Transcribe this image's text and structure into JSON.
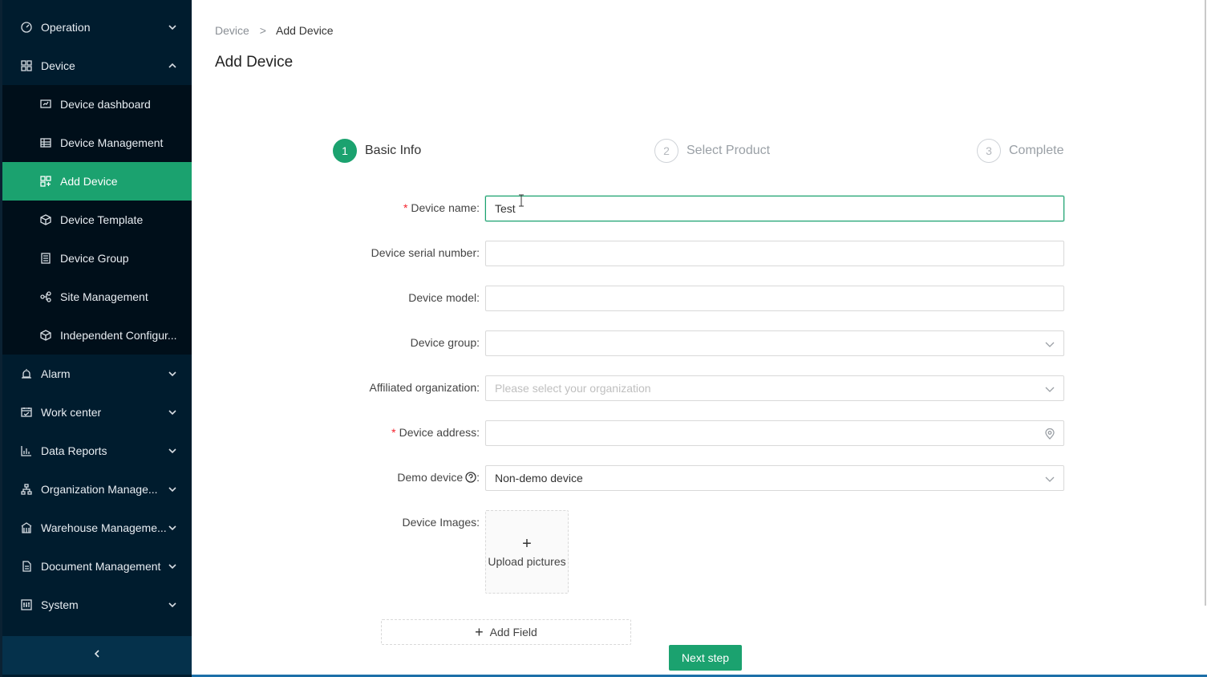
{
  "sidebar": {
    "items": [
      {
        "label": "Operation",
        "icon": "dashboard-gauge-icon"
      },
      {
        "label": "Device",
        "icon": "grid-apps-icon"
      },
      {
        "label": "Device dashboard",
        "icon": "chart-board-icon"
      },
      {
        "label": "Device Management",
        "icon": "table-icon"
      },
      {
        "label": "Add Device",
        "icon": "grid-add-icon"
      },
      {
        "label": "Device Template",
        "icon": "cube-template-icon"
      },
      {
        "label": "Device Group",
        "icon": "list-group-icon"
      },
      {
        "label": "Site Management",
        "icon": "site-nodes-icon"
      },
      {
        "label": "Independent Configur...",
        "icon": "cube-config-icon"
      },
      {
        "label": "Alarm",
        "icon": "alarm-bell-icon"
      },
      {
        "label": "Work center",
        "icon": "calendar-work-icon"
      },
      {
        "label": "Data Reports",
        "icon": "bar-chart-icon"
      },
      {
        "label": "Organization Manage...",
        "icon": "org-tree-icon"
      },
      {
        "label": "Warehouse Manageme...",
        "icon": "warehouse-icon"
      },
      {
        "label": "Document Management",
        "icon": "document-icon"
      },
      {
        "label": "System",
        "icon": "system-settings-icon"
      }
    ]
  },
  "breadcrumb": {
    "parent": "Device",
    "separator": ">",
    "current": "Add Device"
  },
  "page_title": "Add Device",
  "steps": [
    {
      "num": "1",
      "label": "Basic Info"
    },
    {
      "num": "2",
      "label": "Select Product"
    },
    {
      "num": "3",
      "label": "Complete"
    }
  ],
  "form": {
    "device_name": {
      "label": "Device name",
      "value": "Test"
    },
    "serial_number": {
      "label": "Device serial number",
      "value": ""
    },
    "model": {
      "label": "Device model",
      "value": ""
    },
    "group": {
      "label": "Device group",
      "value": ""
    },
    "organization": {
      "label": "Affiliated organization",
      "placeholder": "Please select your organization"
    },
    "address": {
      "label": "Device address",
      "value": ""
    },
    "demo": {
      "label": "Demo device",
      "value": "Non-demo device"
    },
    "images": {
      "label": "Device Images",
      "upload_label": "Upload pictures"
    },
    "colon": ":",
    "required_mark": "*"
  },
  "actions": {
    "add_field": "Add Field",
    "next": "Next step",
    "plus": "+"
  },
  "colors": {
    "accent": "#1ba26f",
    "sidebar": "#001c2e",
    "required": "#f5222d"
  }
}
